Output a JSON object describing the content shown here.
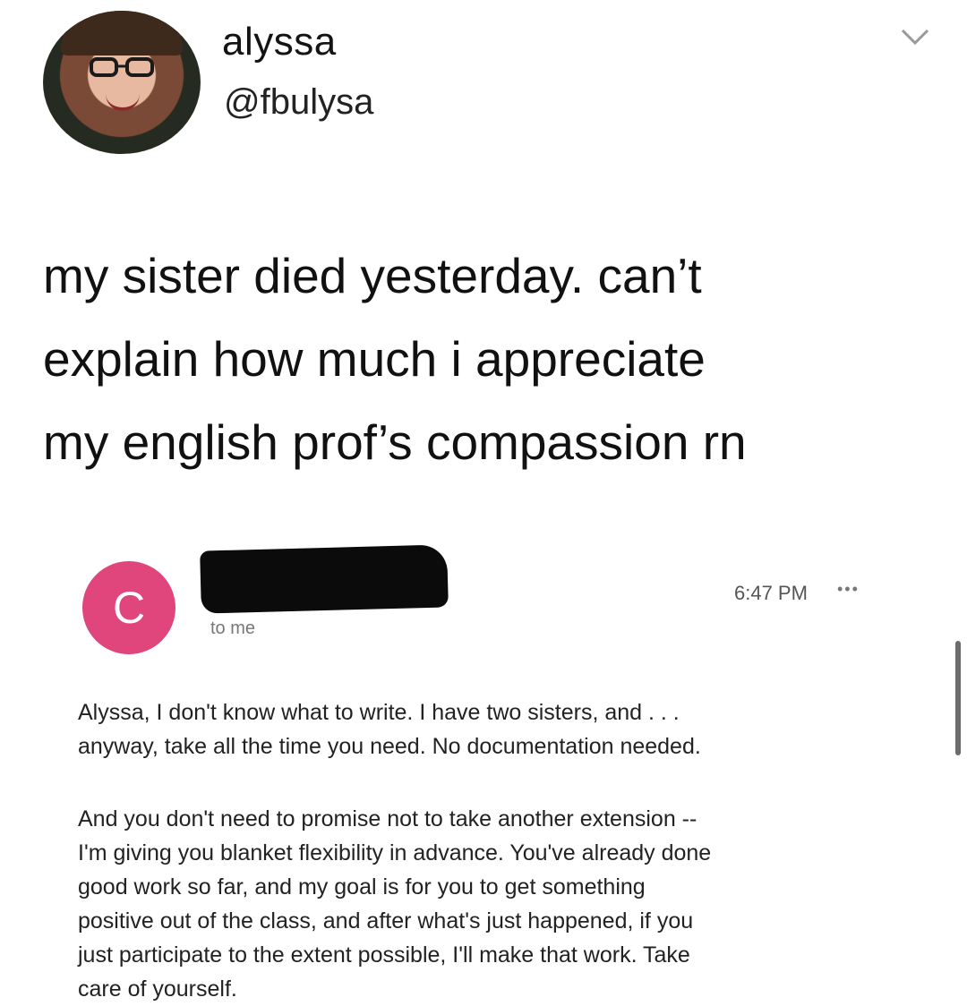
{
  "tweet": {
    "display_name": "alyssa",
    "handle": "@fbulysa",
    "lines": [
      "my sister died yesterday. can’t",
      "explain how much i appreciate",
      "my english prof’s compassion rn"
    ]
  },
  "email": {
    "sender_initial": "C",
    "recipient": "to me",
    "time": "6:47 PM",
    "more_glyph": "•••",
    "paragraph1": [
      "Alyssa, I don't know what to write. I have two sisters, and . . .",
      "anyway, take all the time you need. No documentation needed."
    ],
    "paragraph2": [
      "And you don't need to promise not to take another extension --",
      "I'm giving you blanket flexibility in advance. You've already done",
      "good work so far, and my goal is for you to get something",
      "positive out of the class, and after what's just happened, if you",
      "just participate to the extent possible, I'll make that work. Take",
      "care of yourself."
    ],
    "avatar_color": "#e0457b"
  },
  "icons": {
    "menu": "chevron-down-icon",
    "more": "more-dots-icon"
  }
}
